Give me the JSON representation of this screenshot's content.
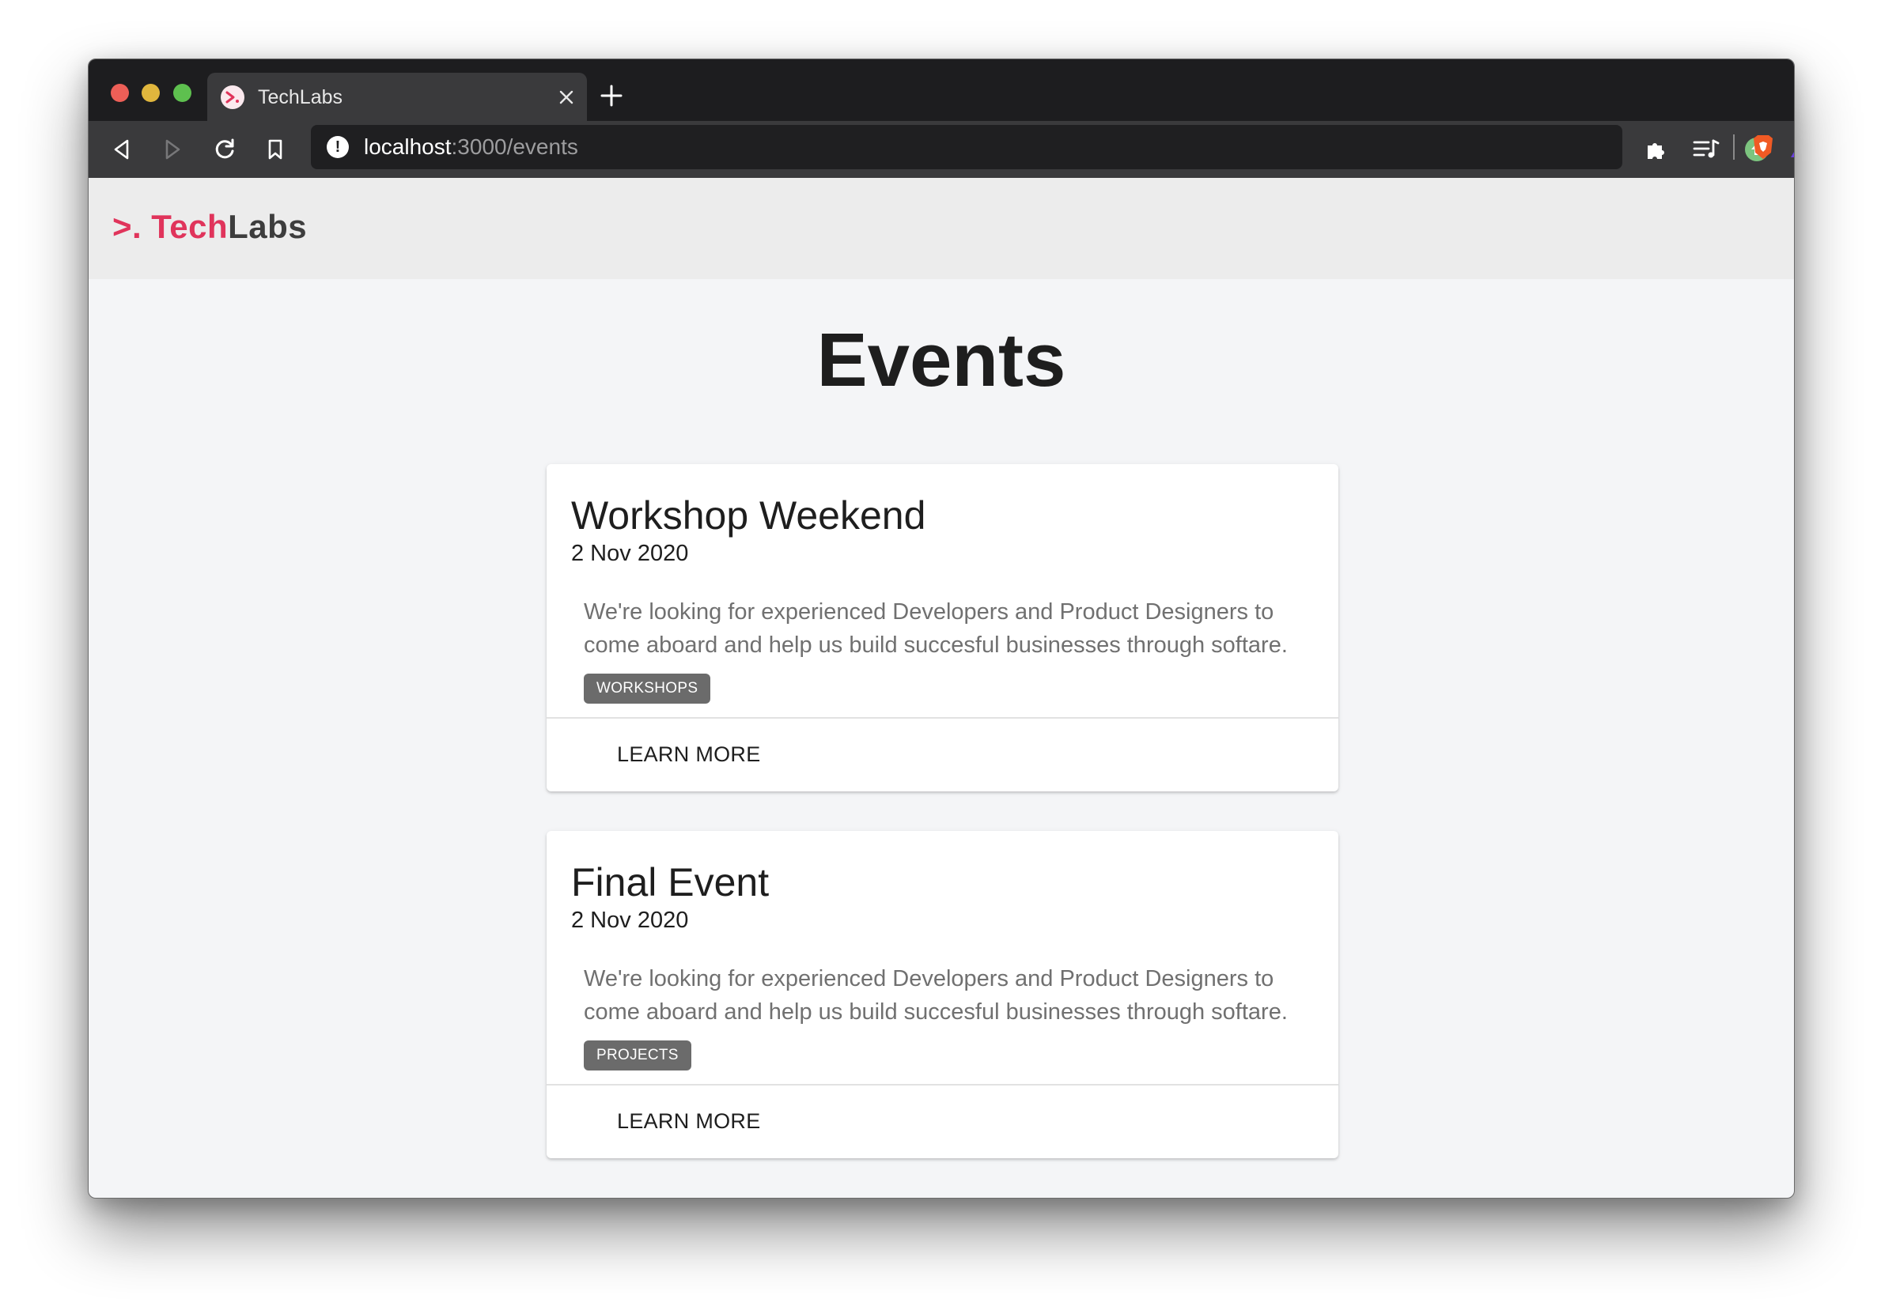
{
  "browser": {
    "tab": {
      "title": "TechLabs"
    },
    "address_bar": {
      "host": "localhost",
      "rest": ":3000/events"
    }
  },
  "site": {
    "logo": {
      "prompt": ">.",
      "tech": "Tech",
      "labs": "Labs"
    },
    "accent_color": "#e0345b"
  },
  "page": {
    "title": "Events",
    "events": [
      {
        "title": "Workshop Weekend",
        "date": "2 Nov 2020",
        "description": "We're looking for experienced Developers and Product Designers to come aboard and help us build succesful businesses through softare.",
        "tag": "WORKSHOPS",
        "action": "LEARN MORE"
      },
      {
        "title": "Final Event",
        "date": "2 Nov 2020",
        "description": "We're looking for experienced Developers and Product Designers to come aboard and help us build succesful businesses through softare.",
        "tag": "PROJECTS",
        "action": "LEARN MORE"
      }
    ]
  },
  "icons": {
    "window": [
      "close-window-icon",
      "minimize-window-icon",
      "maximize-window-icon"
    ],
    "tab": [
      "techlabs-favicon-icon",
      "close-tab-icon",
      "new-tab-icon"
    ],
    "toolbar": [
      "back-icon",
      "forward-icon",
      "reload-icon",
      "bookmark-icon",
      "site-info-icon",
      "brave-shields-icon",
      "brave-rewards-icon",
      "extensions-icon",
      "media-playlist-icon",
      "profile-update-icon"
    ]
  }
}
